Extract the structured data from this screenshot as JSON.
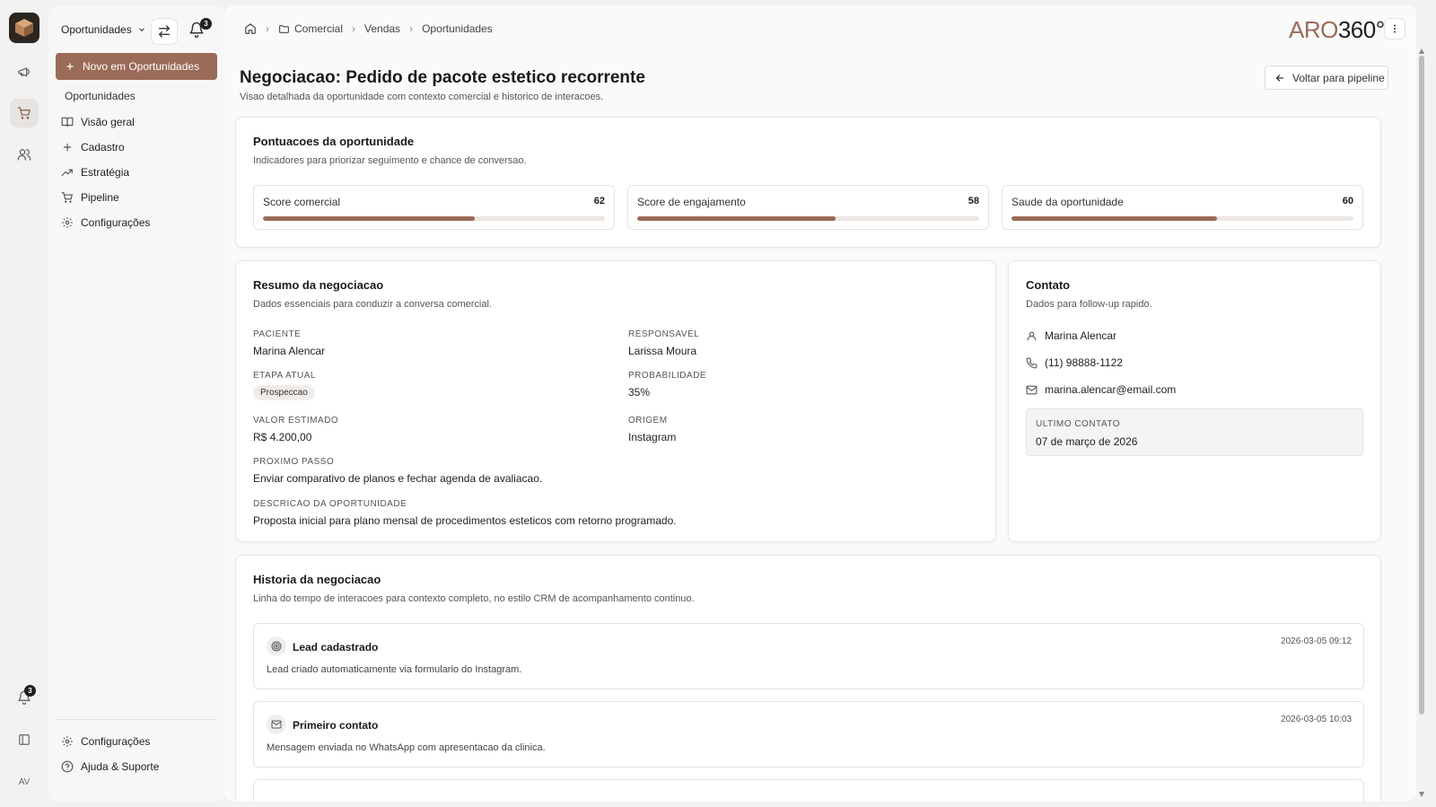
{
  "rail": {
    "avatar_initials": "AV",
    "notification_count": "3"
  },
  "sidebar": {
    "module_selector": "Oportunidades",
    "notification_count": "3",
    "new_button": "Novo em Oportunidades",
    "section_label": "Oportunidades",
    "items": [
      {
        "label": "Visão geral",
        "icon": "book-open-icon"
      },
      {
        "label": "Cadastro",
        "icon": "plus-icon"
      },
      {
        "label": "Estratégia",
        "icon": "trending-up-icon"
      },
      {
        "label": "Pipeline",
        "icon": "cart-icon"
      },
      {
        "label": "Configurações",
        "icon": "gear-icon"
      }
    ],
    "footer": [
      {
        "label": "Configurações",
        "icon": "gear-icon"
      },
      {
        "label": "Ajuda & Suporte",
        "icon": "help-circle-icon"
      }
    ]
  },
  "breadcrumb": {
    "items": [
      "Comercial",
      "Vendas",
      "Oportunidades"
    ]
  },
  "brand": {
    "aro": "ARO",
    "num": "360°"
  },
  "page": {
    "title": "Negociacao: Pedido de pacote estetico recorrente",
    "subtitle": "Visao detalhada da oportunidade com contexto comercial e historico de interacoes.",
    "back_button": "Voltar para pipeline"
  },
  "scores": {
    "title": "Pontuacoes da oportunidade",
    "subtitle": "Indicadores para priorizar seguimento e chance de conversao.",
    "items": [
      {
        "label": "Score comercial",
        "value": "62",
        "percent": 62
      },
      {
        "label": "Score de engajamento",
        "value": "58",
        "percent": 58
      },
      {
        "label": "Saude da oportunidade",
        "value": "60",
        "percent": 60
      }
    ]
  },
  "summary": {
    "title": "Resumo da negociacao",
    "subtitle": "Dados essenciais para conduzir a conversa comercial.",
    "paciente_label": "PACIENTE",
    "paciente": "Marina Alencar",
    "responsavel_label": "RESPONSAVEL",
    "responsavel": "Larissa Moura",
    "etapa_label": "ETAPA ATUAL",
    "etapa": "Prospeccao",
    "probabilidade_label": "PROBABILIDADE",
    "probabilidade": "35%",
    "valor_label": "VALOR ESTIMADO",
    "valor": "R$ 4.200,00",
    "origem_label": "ORIGEM",
    "origem": "Instagram",
    "proximo_label": "PROXIMO PASSO",
    "proximo": "Enviar comparativo de planos e fechar agenda de avaliacao.",
    "descricao_label": "DESCRICAO DA OPORTUNIDADE",
    "descricao": "Proposta inicial para plano mensal de procedimentos esteticos com retorno programado."
  },
  "contact": {
    "title": "Contato",
    "subtitle": "Dados para follow-up rapido.",
    "name": "Marina Alencar",
    "phone": "(11) 98888-1122",
    "email": "marina.alencar@email.com",
    "last_contact_label": "ULTIMO CONTATO",
    "last_contact": "07 de março de 2026"
  },
  "history": {
    "title": "Historia da negociacao",
    "subtitle": "Linha do tempo de interacoes para contexto completo, no estilo CRM de acompanhamento continuo.",
    "items": [
      {
        "title": "Lead cadastrado",
        "time": "2026-03-05 09:12",
        "desc": "Lead criado automaticamente via formulario do Instagram.",
        "icon": "target-icon"
      },
      {
        "title": "Primeiro contato",
        "time": "2026-03-05 10:03",
        "desc": "Mensagem enviada no WhatsApp com apresentacao da clinica.",
        "icon": "mail-icon"
      }
    ]
  },
  "colors": {
    "accent": "#9a6b57",
    "bar_track": "#ece6e3"
  }
}
